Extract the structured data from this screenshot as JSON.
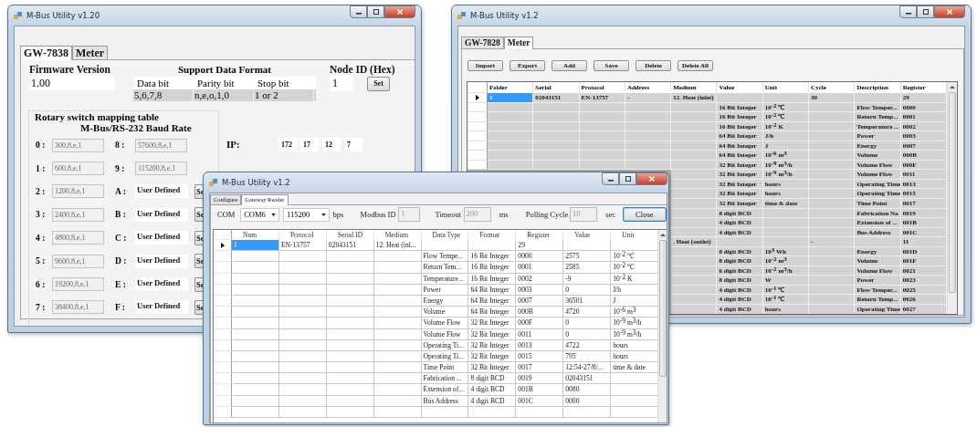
{
  "gateway_window": {
    "title": "M-Bus Utility v1.20",
    "tabs": [
      {
        "label": "GW-7838",
        "selected": true
      },
      {
        "label": "Meter",
        "selected": false
      }
    ],
    "firmware": {
      "label": "Firmware Version",
      "value": "1.00"
    },
    "data_format": {
      "title": "Support Data Format",
      "columns": [
        "Data bit",
        "Parity bit",
        "Stop bit"
      ],
      "values": [
        "5,6,7,8",
        "n,e,o,1,0",
        "1 or 2"
      ]
    },
    "node_id": {
      "label": "Node ID (Hex)",
      "value": "1",
      "button": "Set"
    },
    "rotary": {
      "title": "Rotary switch mapping table",
      "subtitle": "M-Bus/RS-232 Baud Rate",
      "rows": [
        {
          "left": {
            "key": "0 :",
            "value": "300,8,e,1"
          },
          "right": {
            "key": "8 :",
            "value": "57600,8,e,1",
            "kind": "fixed"
          }
        },
        {
          "left": {
            "key": "1 :",
            "value": "600,8,e,1"
          },
          "right": {
            "key": "9 :",
            "value": "115200,8,e,1",
            "kind": "fixed"
          }
        },
        {
          "left": {
            "key": "2 :",
            "value": "1200,8,e,1"
          },
          "right": {
            "key": "A :",
            "value": "User Defined",
            "kind": "custom",
            "button": "Se"
          }
        },
        {
          "left": {
            "key": "3 :",
            "value": "2400,8,e,1"
          },
          "right": {
            "key": "B :",
            "value": "User Defined",
            "kind": "custom",
            "button": "Se"
          }
        },
        {
          "left": {
            "key": "4 :",
            "value": "4800,8,e,1"
          },
          "right": {
            "key": "C :",
            "value": "User Defined",
            "kind": "custom",
            "button": "Se"
          }
        },
        {
          "left": {
            "key": "5 :",
            "value": "9600,8,e,1"
          },
          "right": {
            "key": "D :",
            "value": "User Defined",
            "kind": "custom",
            "button": "Se"
          }
        },
        {
          "left": {
            "key": "6 :",
            "value": "19200,8,e,1"
          },
          "right": {
            "key": "E :",
            "value": "User Defined",
            "kind": "custom",
            "button": "Se"
          }
        },
        {
          "left": {
            "key": "7 :",
            "value": "38400,8,e,1"
          },
          "right": {
            "key": "F :",
            "value": "User Defined",
            "kind": "custom",
            "button": "Se"
          }
        }
      ]
    },
    "ip": {
      "label": "IP:",
      "octets": [
        "172",
        "17",
        "12",
        "7"
      ]
    }
  },
  "meter_window": {
    "title": "M-Bus Utility v1.2",
    "tabs": [
      {
        "label": "GW-7828",
        "selected": false
      },
      {
        "label": "Meter",
        "selected": true
      }
    ],
    "buttons": [
      "Import",
      "Export",
      "Add",
      "Save",
      "Delete",
      "Delete All"
    ],
    "table": {
      "columns": [
        "Folder",
        "Serial",
        "Protocol",
        "Address",
        "Medium",
        "Value",
        "Unit",
        "Cycle",
        "Description",
        "Register"
      ],
      "rows": [
        {
          "selected": true,
          "cells": {
            "folder": "1",
            "serial": "02043151",
            "protocol": "EN-13757",
            "address": "-",
            "medium": "12. Heat (inlet)",
            "cycle": "30",
            "register": "29"
          }
        },
        {
          "selected": false,
          "cells": {
            "value": "16 Bit Integer",
            "unit": "10$^{-2}$ ℃",
            "description": "Flow Temper...",
            "register": "0000"
          }
        },
        {
          "selected": false,
          "cells": {
            "value": "16 Bit Integer",
            "unit": "10$^{-2}$ ℃",
            "description": "Return Temp...",
            "register": "0001"
          }
        },
        {
          "selected": false,
          "cells": {
            "value": "16 Bit Integer",
            "unit": "10$^{-2}$ K",
            "description": "Temperature ...",
            "register": "0002"
          }
        },
        {
          "selected": false,
          "cells": {
            "value": "64 Bit Integer",
            "unit": "J/h",
            "description": "Power",
            "register": "0003"
          }
        },
        {
          "selected": false,
          "cells": {
            "value": "64 Bit Integer",
            "unit": "J",
            "description": "Energy",
            "register": "0007"
          }
        },
        {
          "selected": false,
          "cells": {
            "value": "64 Bit Integer",
            "unit": "10$^{-6}$ m$^{3}$",
            "description": "Volume",
            "register": "000B"
          }
        },
        {
          "selected": false,
          "cells": {
            "value": "32 Bit Integer",
            "unit": "10$^{-9}$ m$^{3}$/h",
            "description": "Volume Flow",
            "register": "000F"
          }
        },
        {
          "selected": false,
          "cells": {
            "value": "32 Bit Integer",
            "unit": "10$^{-9}$ m$^{3}$/h",
            "description": "Volume Flow",
            "register": "0011"
          }
        },
        {
          "selected": false,
          "cells": {
            "value": "32 Bit Integer",
            "unit": "hours",
            "description": "Operating Time",
            "register": "0013"
          }
        },
        {
          "selected": false,
          "cells": {
            "value": "32 Bit Integer",
            "unit": "hours",
            "description": "Operating Time",
            "register": "0015"
          }
        },
        {
          "selected": false,
          "cells": {
            "value": "32 Bit Integer",
            "unit": "time & date",
            "description": "Time Point",
            "register": "0017"
          }
        },
        {
          "selected": false,
          "cells": {
            "value": "8 digit BCD",
            "description": "Fabrication No",
            "register": "0019"
          }
        },
        {
          "selected": false,
          "cells": {
            "value": "4 digit BCD",
            "description": "Extension of ...",
            "register": "001B"
          }
        },
        {
          "selected": false,
          "cells": {
            "value": "4 digit BCD",
            "description": "Bus Address",
            "register": "001C"
          }
        },
        {
          "selected": false,
          "cells": {
            "medium": ". Heat (outlet)",
            "cycle": "-",
            "register": "11"
          }
        },
        {
          "selected": false,
          "cells": {
            "value": "8 digit BCD",
            "unit": "10$^{3}$ Wh",
            "description": "Energy",
            "register": "001D"
          }
        },
        {
          "selected": false,
          "cells": {
            "value": "8 digit BCD",
            "unit": "10$^{-2}$ m$^{3}$",
            "description": "Volume",
            "register": "001F"
          }
        },
        {
          "selected": false,
          "cells": {
            "value": "6 digit BCD",
            "unit": "10$^{-2}$ m$^{3}$/h",
            "description": "Volume Flow",
            "register": "0021"
          }
        },
        {
          "selected": false,
          "cells": {
            "value": "8 digit BCD",
            "unit": "W",
            "description": "Power",
            "register": "0023"
          }
        },
        {
          "selected": false,
          "cells": {
            "value": "4 digit BCD",
            "unit": "10$^{-1}$ ℃",
            "description": "Flow Temper...",
            "register": "0025"
          }
        },
        {
          "selected": false,
          "cells": {
            "value": "4 digit BCD",
            "unit": "10$^{-1}$ ℃",
            "description": "Return Temp...",
            "register": "0026"
          }
        },
        {
          "selected": false,
          "cells": {
            "value": "4 digit BCD",
            "unit": "hours",
            "description": "Operating Time",
            "register": "0027"
          }
        }
      ]
    }
  },
  "reader_window": {
    "title": "M-Bus Utility v1.2",
    "tabs": [
      {
        "label": "Configure",
        "selected": false
      },
      {
        "label": "Gateway Reader",
        "selected": true
      }
    ],
    "com": {
      "label": "COM",
      "port": "COM6",
      "baud": "115200",
      "unit": "bps"
    },
    "modbus_id": {
      "label": "Modbus ID",
      "value": "1",
      "disabled": true
    },
    "timeout": {
      "label": "Timeout",
      "value": "200",
      "unit": "ms",
      "disabled": true
    },
    "polling": {
      "label": "Polling Cycle",
      "value": "10",
      "unit": "sec",
      "disabled": true
    },
    "close_button": "Close",
    "table": {
      "columns": [
        "Num",
        "Protocol",
        "Serial ID",
        "Medium",
        "Data Type",
        "Format",
        "Register",
        "Value",
        "Unit"
      ],
      "rows": [
        {
          "selected": true,
          "cells": {
            "num": "1",
            "protocol": "EN-13757",
            "serial_id": "02043151",
            "medium": "12. Heat (inl...",
            "register": "29"
          }
        },
        {
          "selected": false,
          "cells": {
            "data_type": "Flow Tempe...",
            "format": "16 Bit Integer",
            "register": "0000",
            "value": "2575",
            "unit": "10$^{-2}$ ℃"
          }
        },
        {
          "selected": false,
          "cells": {
            "data_type": "Return Tem...",
            "format": "16 Bit Integer",
            "register": "0001",
            "value": "2585",
            "unit": "10$^{-2}$ ℃"
          }
        },
        {
          "selected": false,
          "cells": {
            "data_type": "Temperature...",
            "format": "16 Bit Integer",
            "register": "0002",
            "value": "-9",
            "unit": "10$^{-2}$ K"
          }
        },
        {
          "selected": false,
          "cells": {
            "data_type": "Power",
            "format": "64 Bit Integer",
            "register": "0003",
            "value": "0",
            "unit": "J/h"
          }
        },
        {
          "selected": false,
          "cells": {
            "data_type": "Energy",
            "format": "64 Bit Integer",
            "register": "0007",
            "value": "36501",
            "unit": "J"
          }
        },
        {
          "selected": false,
          "cells": {
            "data_type": "Volume",
            "format": "64 Bit Integer",
            "register": "000B",
            "value": "4720",
            "unit": "10$^{-6}$ m$^{3}$"
          }
        },
        {
          "selected": false,
          "cells": {
            "data_type": "Volume Flow",
            "format": "32 Bit Integer",
            "register": "000F",
            "value": "0",
            "unit": "10$^{-9}$ m$^{3}$/h"
          }
        },
        {
          "selected": false,
          "cells": {
            "data_type": "Volume Flow",
            "format": "32 Bit Integer",
            "register": "0011",
            "value": "0",
            "unit": "10$^{-9}$ m$^{3}$/h"
          }
        },
        {
          "selected": false,
          "cells": {
            "data_type": "Operating Ti...",
            "format": "32 Bit Integer",
            "register": "0013",
            "value": "4722",
            "unit": "hours"
          }
        },
        {
          "selected": false,
          "cells": {
            "data_type": "Operating Ti...",
            "format": "32 Bit Integer",
            "register": "0015",
            "value": "795",
            "unit": "hours"
          }
        },
        {
          "selected": false,
          "cells": {
            "data_type": "Time Point",
            "format": "32 Bit Integer",
            "register": "0017",
            "value": "12:54-27/8/...",
            "unit": "time & date"
          }
        },
        {
          "selected": false,
          "cells": {
            "data_type": "Fabrication ...",
            "format": "8 digit BCD",
            "register": "0019",
            "value": "02043151"
          }
        },
        {
          "selected": false,
          "cells": {
            "data_type": "Extension of...",
            "format": "4 digit BCD",
            "register": "001B",
            "value": "0080"
          }
        },
        {
          "selected": false,
          "cells": {
            "data_type": "Bus Address",
            "format": "4 digit BCD",
            "register": "001C",
            "value": "0000"
          }
        }
      ]
    }
  }
}
